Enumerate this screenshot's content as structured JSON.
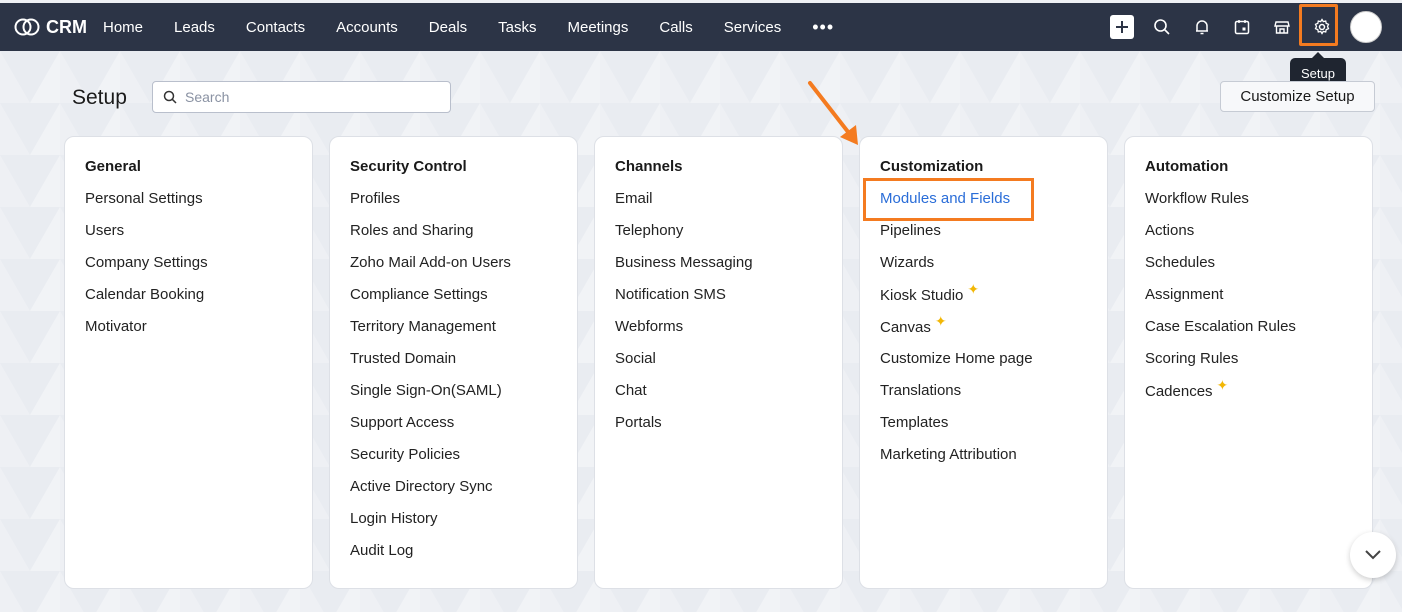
{
  "app": {
    "name": "CRM"
  },
  "nav": [
    "Home",
    "Leads",
    "Contacts",
    "Accounts",
    "Deals",
    "Tasks",
    "Meetings",
    "Calls",
    "Services"
  ],
  "nav_more": "•••",
  "tooltip": "Setup",
  "page": {
    "title": "Setup",
    "search_placeholder": "Search",
    "customize_button": "Customize Setup"
  },
  "cards": [
    {
      "title": "General",
      "items": [
        "Personal Settings",
        "Users",
        "Company Settings",
        "Calendar Booking",
        "Motivator"
      ]
    },
    {
      "title": "Security Control",
      "items": [
        "Profiles",
        "Roles and Sharing",
        "Zoho Mail Add-on Users",
        "Compliance Settings",
        "Territory Management",
        "Trusted Domain",
        "Single Sign-On(SAML)",
        "Support Access",
        "Security Policies",
        "Active Directory Sync",
        "Login History",
        "Audit Log"
      ]
    },
    {
      "title": "Channels",
      "items": [
        "Email",
        "Telephony",
        "Business Messaging",
        "Notification SMS",
        "Webforms",
        "Social",
        "Chat",
        "Portals"
      ]
    },
    {
      "title": "Customization",
      "items": [
        "Modules and Fields",
        "Pipelines",
        "Wizards",
        "Kiosk Studio",
        "Canvas",
        "Customize Home page",
        "Translations",
        "Templates",
        "Marketing Attribution"
      ]
    },
    {
      "title": "Automation",
      "items": [
        "Workflow Rules",
        "Actions",
        "Schedules",
        "Assignment",
        "Case Escalation Rules",
        "Scoring Rules",
        "Cadences"
      ]
    }
  ],
  "colors": {
    "topbar": "#2c3446",
    "highlight": "#f47b20",
    "link": "#2a6dd8",
    "sparkle": "#f2b705"
  }
}
